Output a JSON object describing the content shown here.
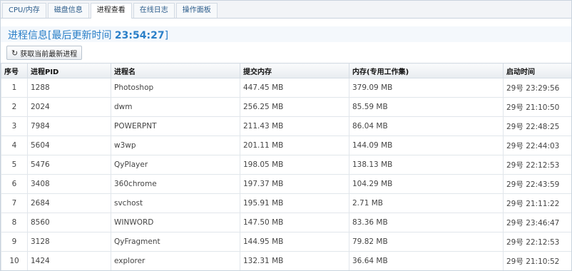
{
  "tabs": [
    {
      "label": "CPU/内存"
    },
    {
      "label": "磁盘信息"
    },
    {
      "label": "进程查看"
    },
    {
      "label": "在线日志"
    },
    {
      "label": "操作面板"
    }
  ],
  "header": {
    "title_prefix": "进程信息[最后更新时间 ",
    "time": "23:54:27",
    "title_suffix": "]"
  },
  "refresh_button": {
    "label": "获取当前最新进程",
    "icon": "refresh-icon"
  },
  "table": {
    "columns": [
      "序号",
      "进程PID",
      "进程名",
      "提交内存",
      "内存(专用工作集)",
      "启动时间"
    ],
    "rows": [
      [
        "1",
        "1288",
        "Photoshop",
        "447.45 MB",
        "379.09 MB",
        "29号 23:29:56"
      ],
      [
        "2",
        "2024",
        "dwm",
        "256.25 MB",
        "85.59 MB",
        "29号 21:10:50"
      ],
      [
        "3",
        "7984",
        "POWERPNT",
        "211.43 MB",
        "86.04 MB",
        "29号 22:48:25"
      ],
      [
        "4",
        "5604",
        "w3wp",
        "201.11 MB",
        "144.09 MB",
        "29号 22:44:03"
      ],
      [
        "5",
        "5476",
        "QyPlayer",
        "198.05 MB",
        "138.13 MB",
        "29号 22:12:53"
      ],
      [
        "6",
        "3408",
        "360chrome",
        "197.37 MB",
        "104.29 MB",
        "29号 22:43:59"
      ],
      [
        "7",
        "2684",
        "svchost",
        "195.91 MB",
        "2.71 MB",
        "29号 21:11:22"
      ],
      [
        "8",
        "8560",
        "WINWORD",
        "147.50 MB",
        "83.36 MB",
        "29号 23:46:47"
      ],
      [
        "9",
        "3128",
        "QyFragment",
        "144.95 MB",
        "79.82 MB",
        "29号 22:12:53"
      ],
      [
        "10",
        "1424",
        "explorer",
        "132.31 MB",
        "36.64 MB",
        "29号 21:10:52"
      ]
    ]
  }
}
